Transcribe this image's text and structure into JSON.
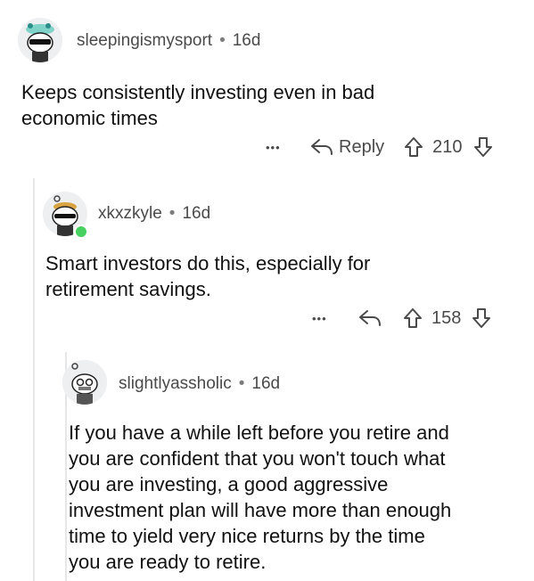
{
  "comments": [
    {
      "username": "sleepingismysport",
      "age": "16d",
      "body_lines": [
        "Keeps consistently investing even in bad",
        "economic times"
      ],
      "more": "•••",
      "reply_label": "Reply",
      "score": "210"
    },
    {
      "username": "xkxzkyle",
      "age": "16d",
      "body_lines": [
        "Smart investors do this, especially for",
        "retirement savings."
      ],
      "more": "•••",
      "score": "158"
    },
    {
      "username": "slightlyassholic",
      "age": "16d",
      "body_lines": [
        "If you have a while left before you retire and",
        "you are confident that you won't touch what",
        "you are investing, a good aggressive",
        "investment plan will have more than enough",
        "time to yield very nice returns by the time",
        "you are ready to retire."
      ]
    }
  ],
  "separator": "•",
  "colors": {
    "online": "#46d160",
    "meta": "#4a4a4a",
    "text": "#111111"
  }
}
